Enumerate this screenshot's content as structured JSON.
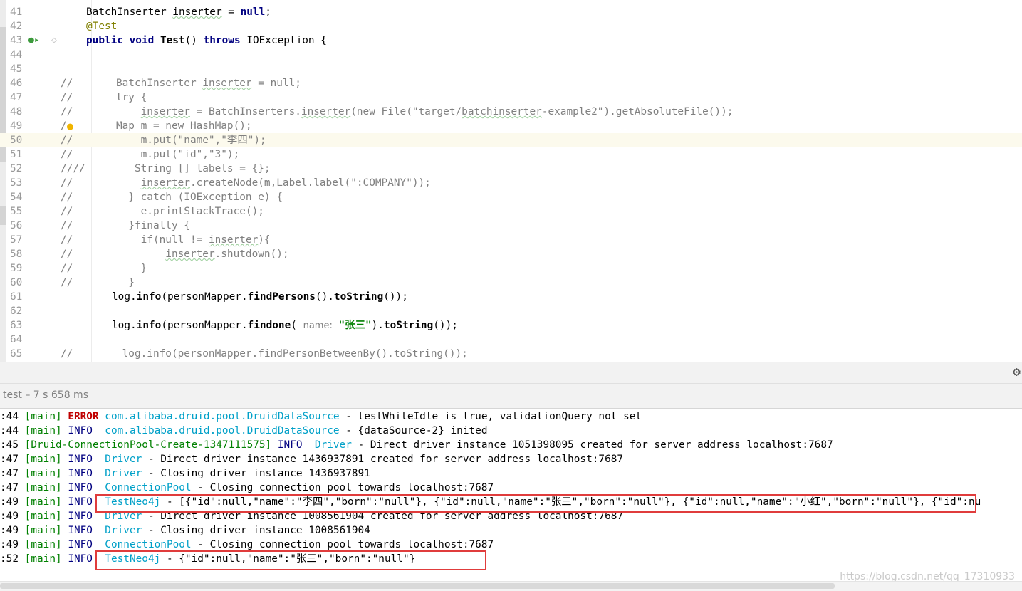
{
  "editor": {
    "lines": [
      {
        "num": "41",
        "html": "    BatchInserter <span class=\"squig\">inserter</span> = <span class=\"kw\">null</span>;",
        "indent": 121
      },
      {
        "num": "42",
        "html": "<span class=\"ann\">@Test</span>",
        "indent": 121
      },
      {
        "num": "43",
        "html": "<span class=\"kw\">public void</span> <span class=\"mth\">Test</span>() <span class=\"kw\">throws</span> IOException {",
        "indent": 121
      },
      {
        "num": "44",
        "html": "",
        "indent": 121
      },
      {
        "num": "45",
        "html": "",
        "indent": 121
      },
      {
        "num": "46",
        "html": "<span class=\"cm\">//       BatchInserter <span class=\"squig\">inserter</span> = null;</span>",
        "indent": 85
      },
      {
        "num": "47",
        "html": "<span class=\"cm\">//       try {</span>",
        "indent": 85
      },
      {
        "num": "48",
        "html": "<span class=\"cm\">//           <span class=\"squig\">inserter</span> = BatchInserters.<span class=\"squig\">inserter</span>(new File(\"target/<span class=\"squig\">batchinserter</span>-example2\").getAbsoluteFile());</span>",
        "indent": 85
      },
      {
        "num": "49",
        "html": "<span class=\"cm\">/        Map m = new HashMap();</span>",
        "indent": 85
      },
      {
        "num": "50",
        "html": "<span class=\"cm\">//           m.put(\"name\",\"李四\");</span>",
        "indent": 85
      },
      {
        "num": "51",
        "html": "<span class=\"cm\">//           m.put(\"id\",\"3\");</span>",
        "indent": 85
      },
      {
        "num": "52",
        "html": "<span class=\"cm\">////        String [] labels = {};</span>",
        "indent": 85
      },
      {
        "num": "53",
        "html": "<span class=\"cm\">//           <span class=\"squig\">inserter</span>.createNode(m,Label.label(\":COMPANY\"));</span>",
        "indent": 85
      },
      {
        "num": "54",
        "html": "<span class=\"cm\">//         } catch (IOException e) {</span>",
        "indent": 85
      },
      {
        "num": "55",
        "html": "<span class=\"cm\">//           e.printStackTrace();</span>",
        "indent": 85
      },
      {
        "num": "56",
        "html": "<span class=\"cm\">//         }finally {</span>",
        "indent": 85
      },
      {
        "num": "57",
        "html": "<span class=\"cm\">//           if(null != <span class=\"squig\">inserter</span>){</span>",
        "indent": 85
      },
      {
        "num": "58",
        "html": "<span class=\"cm\">//               <span class=\"squig\">inserter</span>.shutdown();</span>",
        "indent": 85
      },
      {
        "num": "59",
        "html": "<span class=\"cm\">//           }</span>",
        "indent": 85
      },
      {
        "num": "60",
        "html": "<span class=\"cm\">//         }</span>",
        "indent": 85
      },
      {
        "num": "61",
        "html": "log.<span class=\"mth\">info</span>(personMapper.<span class=\"mth\">findPersons</span>().<span class=\"mth\">toString</span>());",
        "indent": 157
      },
      {
        "num": "62",
        "html": "",
        "indent": 157
      },
      {
        "num": "63",
        "html": "log.<span class=\"mth\">info</span>(personMapper.<span class=\"mth\">findone</span>( <span class=\"hint\">name:</span> <span class=\"str\">\"张三\"</span>).<span class=\"mth\">toString</span>());",
        "indent": 157
      },
      {
        "num": "64",
        "html": "",
        "indent": 157
      },
      {
        "num": "65",
        "html": "<span class=\"cm\">//        log.info(personMapper.findPersonBetweenBy().toString());</span>",
        "indent": 85
      }
    ],
    "highlight_line": "50",
    "gutter_icons": {
      "run": "run-test-icon",
      "bulb": "lightbulb-icon"
    }
  },
  "run": {
    "title": "test – 7 s 658 ms",
    "settings_icon": "gear-icon"
  },
  "console": {
    "lines": [
      {
        "time": ":44",
        "thread": "[main]",
        "level": "ERROR",
        "logger": "com.alibaba.druid.pool.DruidDataSource",
        "msg": " - testWhileIdle is true, validationQuery not set"
      },
      {
        "time": ":44",
        "thread": "[main]",
        "level": "INFO ",
        "logger": "com.alibaba.druid.pool.DruidDataSource",
        "msg": " - {dataSource-2} inited"
      },
      {
        "time": ":45",
        "thread": "[Druid-ConnectionPool-Create-1347111575]",
        "level": "INFO ",
        "logger": "Driver",
        "msg": " - Direct driver instance 1051398095 created for server address localhost:7687"
      },
      {
        "time": ":47",
        "thread": "[main]",
        "level": "INFO ",
        "logger": "Driver",
        "msg": " - Direct driver instance 1436937891 created for server address localhost:7687"
      },
      {
        "time": ":47",
        "thread": "[main]",
        "level": "INFO ",
        "logger": "Driver",
        "msg": " - Closing driver instance 1436937891"
      },
      {
        "time": ":47",
        "thread": "[main]",
        "level": "INFO ",
        "logger": "ConnectionPool",
        "msg": " - Closing connection pool towards localhost:7687"
      },
      {
        "time": ":49",
        "thread": "[main]",
        "level": "INFO ",
        "logger": "TestNeo4j",
        "msg": " - [{\"id\":null,\"name\":\"李四\",\"born\":\"null\"}, {\"id\":null,\"name\":\"张三\",\"born\":\"null\"}, {\"id\":null,\"name\":\"小红\",\"born\":\"null\"}, {\"id\":nu"
      },
      {
        "time": ":49",
        "thread": "[main]",
        "level": "INFO ",
        "logger": "Driver",
        "msg": " - Direct driver instance 1008561904 created for server address localhost:7687"
      },
      {
        "time": ":49",
        "thread": "[main]",
        "level": "INFO ",
        "logger": "Driver",
        "msg": " - Closing driver instance 1008561904"
      },
      {
        "time": ":49",
        "thread": "[main]",
        "level": "INFO ",
        "logger": "ConnectionPool",
        "msg": " - Closing connection pool towards localhost:7687"
      },
      {
        "time": ":52",
        "thread": "[main]",
        "level": "INFO ",
        "logger": "TestNeo4j",
        "msg": " - {\"id\":null,\"name\":\"张三\",\"born\":\"null\"}"
      }
    ]
  },
  "watermark": "https://blog.csdn.net/qq_17310933",
  "colors": {
    "highlight_box": "#e03c3c",
    "logger": "#00a0c8",
    "thread": "#008000",
    "error": "#c00000",
    "info": "#000080"
  }
}
